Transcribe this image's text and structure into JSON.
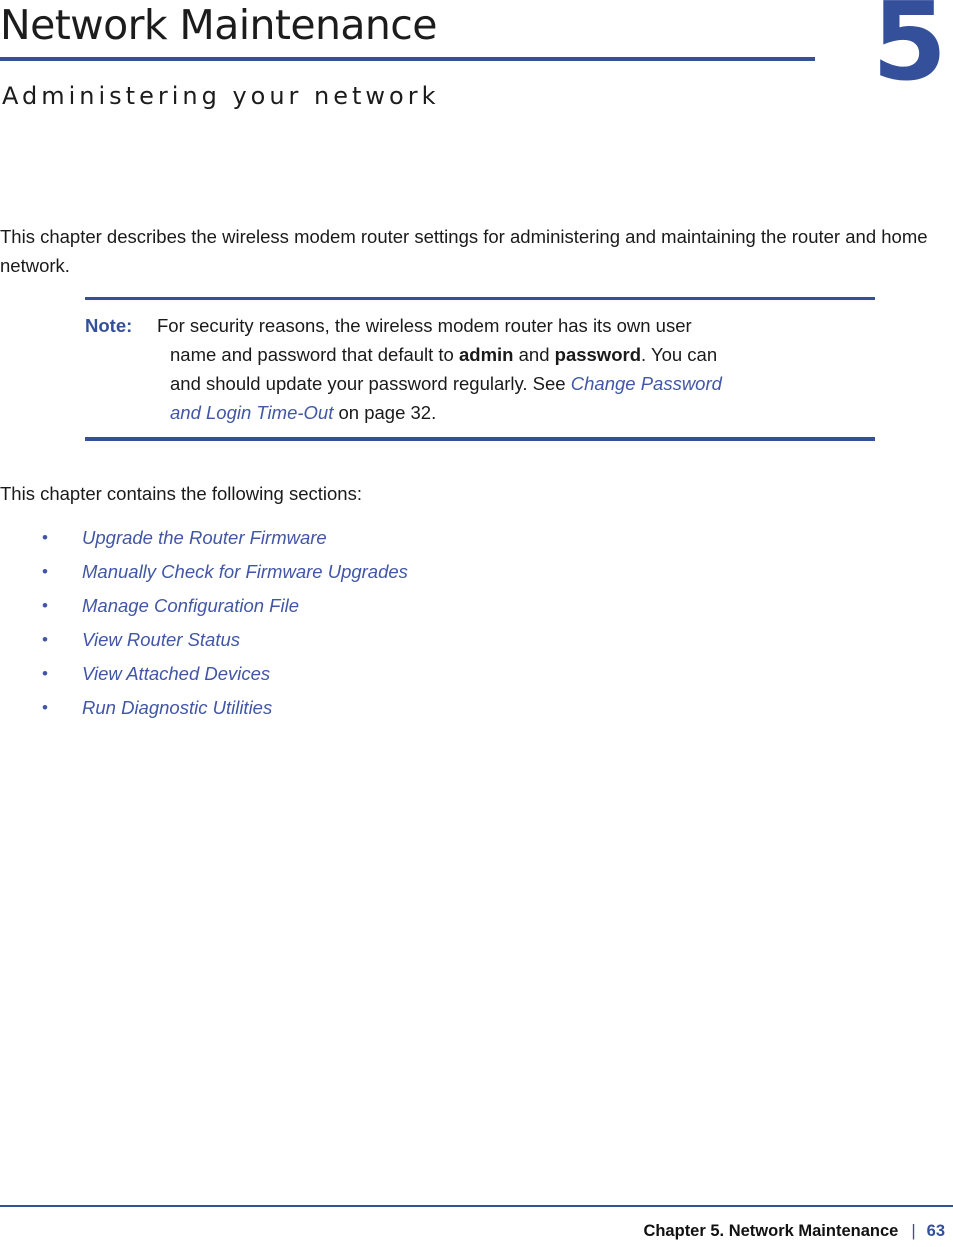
{
  "header": {
    "title": "Network Maintenance",
    "subtitle": "Administering your network",
    "chapter_number": "5",
    "accent_color": "#35509a"
  },
  "intro": {
    "paragraph": "This chapter describes the wireless modem router settings for administering and maintaining the router and home network."
  },
  "note": {
    "label": "Note:",
    "line1_text": "For security reasons, the wireless modem router has its own user",
    "line2_a": "name and password that default to ",
    "line2_bold1": "admin",
    "line2_b": " and ",
    "line2_bold2": "password",
    "line2_c": ". You can",
    "line3_a": "and should update your password regularly. See ",
    "line3_link": "Change Password",
    "line4_link": "and Login Time-Out",
    "line4_b": " on page 32."
  },
  "sections": {
    "lead": "This chapter contains the following sections:",
    "bullet_glyph": "•",
    "items": [
      {
        "label": "Upgrade the Router Firmware"
      },
      {
        "label": "Manually Check for Firmware Upgrades"
      },
      {
        "label": "Manage Configuration File"
      },
      {
        "label": "View Router Status"
      },
      {
        "label": "View Attached Devices"
      },
      {
        "label": "Run Diagnostic Utilities"
      }
    ]
  },
  "footer": {
    "chapter_text": "Chapter 5.  Network Maintenance",
    "separator": "|",
    "page_number": "63"
  }
}
